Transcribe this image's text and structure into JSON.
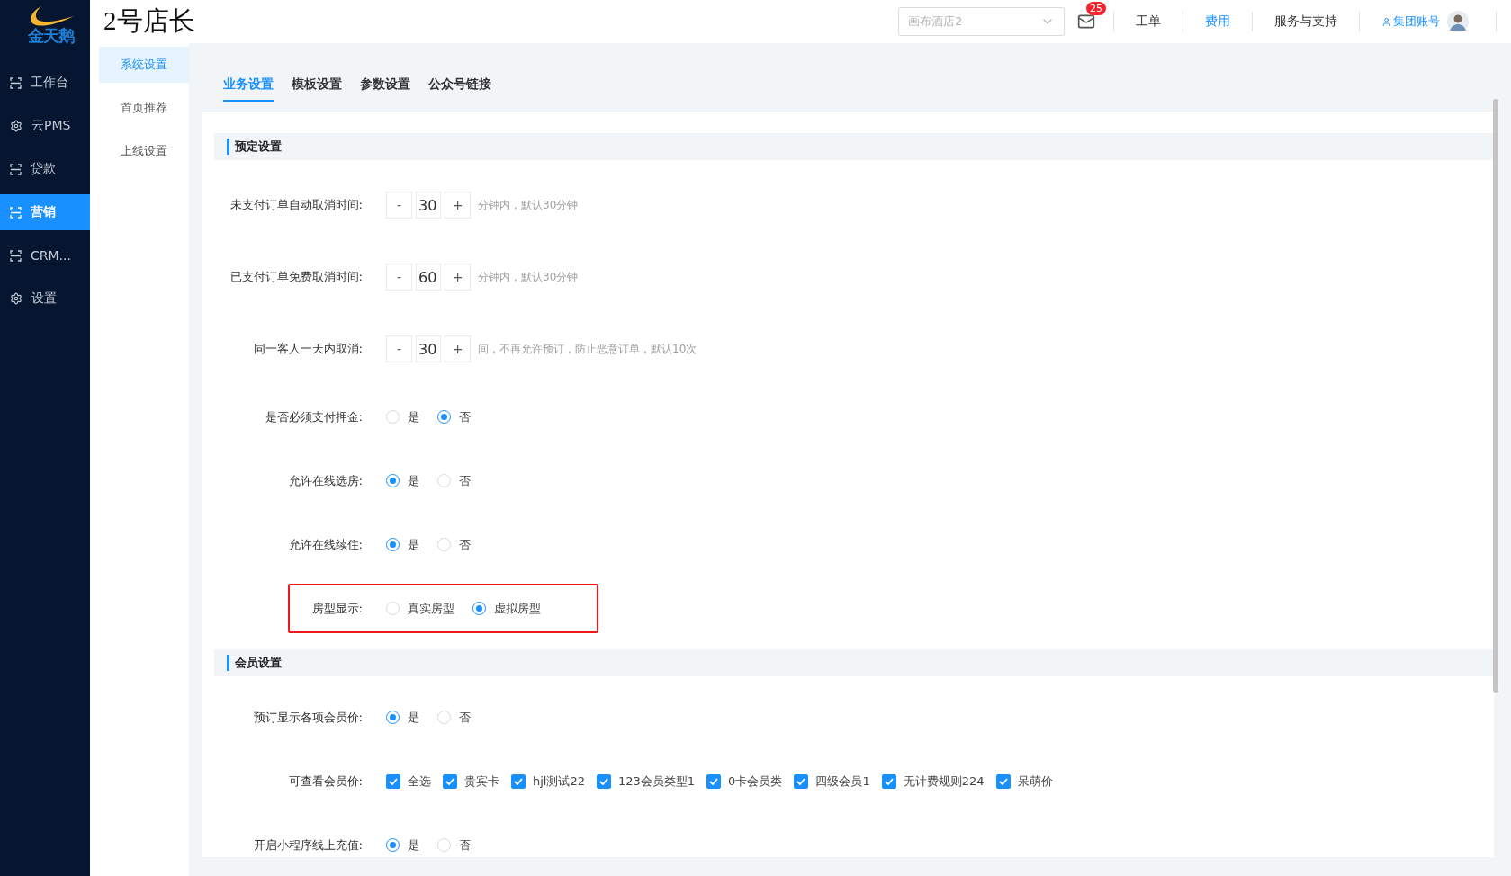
{
  "logo": {
    "text": "金天鹅"
  },
  "nav": [
    {
      "label": "工作台",
      "kind": "frame",
      "selected": false
    },
    {
      "label": "云PMS",
      "kind": "gear",
      "selected": false
    },
    {
      "label": "贷款",
      "kind": "frame",
      "selected": false
    },
    {
      "label": "营销",
      "kind": "frame",
      "selected": true
    },
    {
      "label": "CRM...",
      "kind": "frame",
      "selected": false
    },
    {
      "label": "设置",
      "kind": "gear",
      "selected": false
    }
  ],
  "header": {
    "title": "2号店长",
    "hotel_select": {
      "placeholder": "画布酒店2"
    },
    "mail_badge": "25",
    "links": [
      {
        "label": "工单",
        "active": false
      },
      {
        "label": "费用",
        "active": true
      },
      {
        "label": "服务与支持",
        "active": false
      }
    ],
    "account": {
      "label": "集团账号"
    }
  },
  "submenu": [
    {
      "label": "系统设置",
      "selected": true
    },
    {
      "label": "首页推荐",
      "selected": false
    },
    {
      "label": "上线设置",
      "selected": false
    }
  ],
  "tabs": [
    {
      "label": "业务设置",
      "selected": true
    },
    {
      "label": "模板设置",
      "selected": false
    },
    {
      "label": "参数设置",
      "selected": false
    },
    {
      "label": "公众号链接",
      "selected": false
    }
  ],
  "sections": [
    {
      "title": "预定设置",
      "rows": [
        {
          "kind": "stepper",
          "label": "未支付订单自动取消时间:",
          "decrement": "-",
          "value": "30",
          "increment": "+",
          "hint": "分钟内，默认30分钟",
          "highlighted": false
        },
        {
          "kind": "stepper",
          "label": "已支付订单免费取消时间:",
          "decrement": "-",
          "value": "60",
          "increment": "+",
          "hint": "分钟内，默认30分钟",
          "highlighted": false
        },
        {
          "kind": "stepper",
          "label": "同一客人一天内取消:",
          "decrement": "-",
          "value": "30",
          "increment": "+",
          "hint": "间，不再允许预订，防止恶意订单，默认10次",
          "highlighted": false
        },
        {
          "kind": "radio",
          "label": "是否必须支付押金:",
          "highlighted": false,
          "options": [
            {
              "label": "是",
              "selected": false
            },
            {
              "label": "否",
              "selected": true
            }
          ]
        },
        {
          "kind": "radio",
          "label": "允许在线选房:",
          "highlighted": false,
          "options": [
            {
              "label": "是",
              "selected": true
            },
            {
              "label": "否",
              "selected": false
            }
          ]
        },
        {
          "kind": "radio",
          "label": "允许在线续住:",
          "highlighted": false,
          "options": [
            {
              "label": "是",
              "selected": true
            },
            {
              "label": "否",
              "selected": false
            }
          ]
        },
        {
          "kind": "radio",
          "label": "房型显示:",
          "highlighted": true,
          "options": [
            {
              "label": "真实房型",
              "selected": false
            },
            {
              "label": "虚拟房型",
              "selected": true
            }
          ]
        }
      ]
    },
    {
      "title": "会员设置",
      "rows": [
        {
          "kind": "radio",
          "label": "预订显示各项会员价:",
          "highlighted": false,
          "options": [
            {
              "label": "是",
              "selected": true
            },
            {
              "label": "否",
              "selected": false
            }
          ]
        },
        {
          "kind": "checkboxes",
          "label": "可查看会员价:",
          "highlighted": false,
          "options": [
            {
              "label": "全选",
              "checked": true
            },
            {
              "label": "贵宾卡",
              "checked": true
            },
            {
              "label": "hjl测试22",
              "checked": true
            },
            {
              "label": "123会员类型1",
              "checked": true
            },
            {
              "label": "0卡会员类",
              "checked": true
            },
            {
              "label": "四级会员1",
              "checked": true
            },
            {
              "label": "无计费规则224",
              "checked": true
            },
            {
              "label": "呆萌价",
              "checked": true
            }
          ]
        },
        {
          "kind": "radio",
          "label": "开启小程序线上充值:",
          "highlighted": false,
          "options": [
            {
              "label": "是",
              "selected": true
            },
            {
              "label": "否",
              "selected": false
            }
          ]
        }
      ]
    }
  ]
}
